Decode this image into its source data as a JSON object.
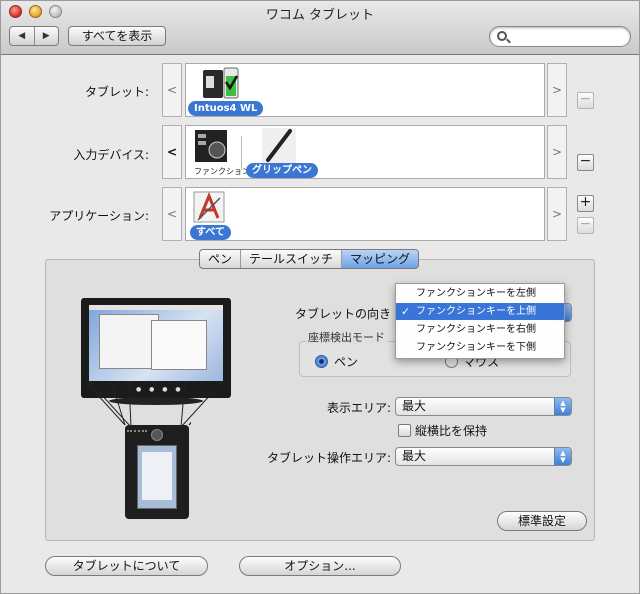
{
  "window": {
    "title": "ワコム タブレット"
  },
  "toolbar": {
    "back": "◀",
    "forward": "▶",
    "show_all": "すべてを表示",
    "search_placeholder": ""
  },
  "rows": {
    "tablet": {
      "label": "タブレット:",
      "item": "Intuos4 WL",
      "prev": "<",
      "next": ">",
      "remove": "−"
    },
    "input_device": {
      "label": "入力デバイス:",
      "item_function": "ファンクション",
      "item_pen": "グリップペン",
      "prev": "<",
      "next": ">",
      "remove": "−"
    },
    "application": {
      "label": "アプリケーション:",
      "item": "すべて",
      "prev": "<",
      "next": ">",
      "add": "+",
      "remove": "−"
    }
  },
  "tabs": [
    {
      "label": "ペン",
      "selected": false
    },
    {
      "label": "テールスイッチ",
      "selected": false
    },
    {
      "label": "マッピング",
      "selected": true
    }
  ],
  "mapping": {
    "orientation_label": "タブレットの向き",
    "orientation_menu": [
      {
        "label": "ファンクションキーを左側",
        "checked": false
      },
      {
        "label": "ファンクションキーを上側",
        "checked": true
      },
      {
        "label": "ファンクションキーを右側",
        "checked": false
      },
      {
        "label": "ファンクションキーを下側",
        "checked": false
      }
    ],
    "coord_mode_title": "座標検出モード",
    "pen_radio": "ペン",
    "mouse_radio": "マウス",
    "display_area_label": "表示エリア:",
    "display_area_value": "最大",
    "keep_aspect_label": "縦横比を保持",
    "tablet_area_label": "タブレット操作エリア:",
    "tablet_area_value": "最大",
    "default_button": "標準設定"
  },
  "footer": {
    "about_button": "タブレットについて",
    "options_button": "オプション..."
  },
  "colors": {
    "selection": "#3875d7",
    "tab_selected": "#6ea2e6"
  }
}
